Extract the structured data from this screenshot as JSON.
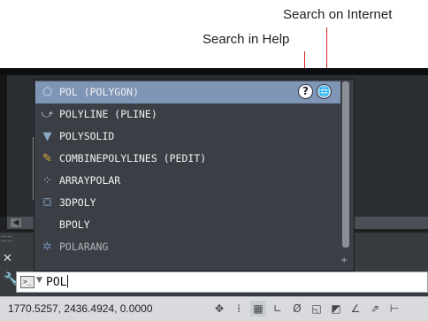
{
  "callouts": {
    "search_internet": "Search on Internet",
    "search_help": "Search in Help"
  },
  "command_line": {
    "input_value": "POL",
    "prompt_icon": "command-prompt-icon",
    "caret_icon": "dropdown-caret-icon"
  },
  "status": {
    "coordinates": "1770.5257, 2436.4924, 0.0000",
    "buttons": [
      {
        "name": "model-space-icon",
        "glyph": "✥",
        "active": false
      },
      {
        "name": "snap-icon",
        "glyph": "⁞",
        "active": false
      },
      {
        "name": "grid-icon",
        "glyph": "▦",
        "active": true
      },
      {
        "name": "ortho-icon",
        "glyph": "∟",
        "active": false
      },
      {
        "name": "polar-icon",
        "glyph": "Ø",
        "active": false
      },
      {
        "name": "object-snap-icon",
        "glyph": "◱",
        "active": false
      },
      {
        "name": "object-tracking-icon",
        "glyph": "◩",
        "active": false
      },
      {
        "name": "dynamic-ucs-icon",
        "glyph": "∠",
        "active": false
      },
      {
        "name": "dynamic-input-icon",
        "glyph": "⇗",
        "active": false
      },
      {
        "name": "lineweight-icon",
        "glyph": "⊢",
        "active": false
      }
    ]
  },
  "autocomplete": {
    "help_icon": "help-icon",
    "internet_icon": "globe-icon",
    "items": [
      {
        "label": "POL (POLYGON)",
        "icon": "polygon-icon",
        "glyph": "⬠",
        "color": "#cfe0f5",
        "selected": true
      },
      {
        "label": "POLYLINE (PLINE)",
        "icon": "polyline-icon",
        "glyph": "⤻",
        "color": "#c0c4c8",
        "selected": false
      },
      {
        "label": "POLYSOLID",
        "icon": "polysolid-icon",
        "glyph": "▼",
        "color": "#8aa8c8",
        "selected": false
      },
      {
        "label": "COMBINEPOLYLINES (PEDIT)",
        "icon": "pedit-icon",
        "glyph": "✎",
        "color": "#e0b040",
        "selected": false
      },
      {
        "label": "ARRAYPOLAR",
        "icon": "array-polar-icon",
        "glyph": "⁘",
        "color": "#c0c4c8",
        "selected": false
      },
      {
        "label": "3DPOLY",
        "icon": "3dpoly-icon",
        "glyph": "⛋",
        "color": "#8fb0d8",
        "selected": false
      },
      {
        "label": "BPOLY",
        "icon": "",
        "glyph": "",
        "color": "#c0c4c8",
        "selected": false
      },
      {
        "label": "POLARANG",
        "icon": "system-variable-icon",
        "glyph": "✲",
        "color": "#6f86b0",
        "selected": false,
        "dim": true
      }
    ]
  }
}
